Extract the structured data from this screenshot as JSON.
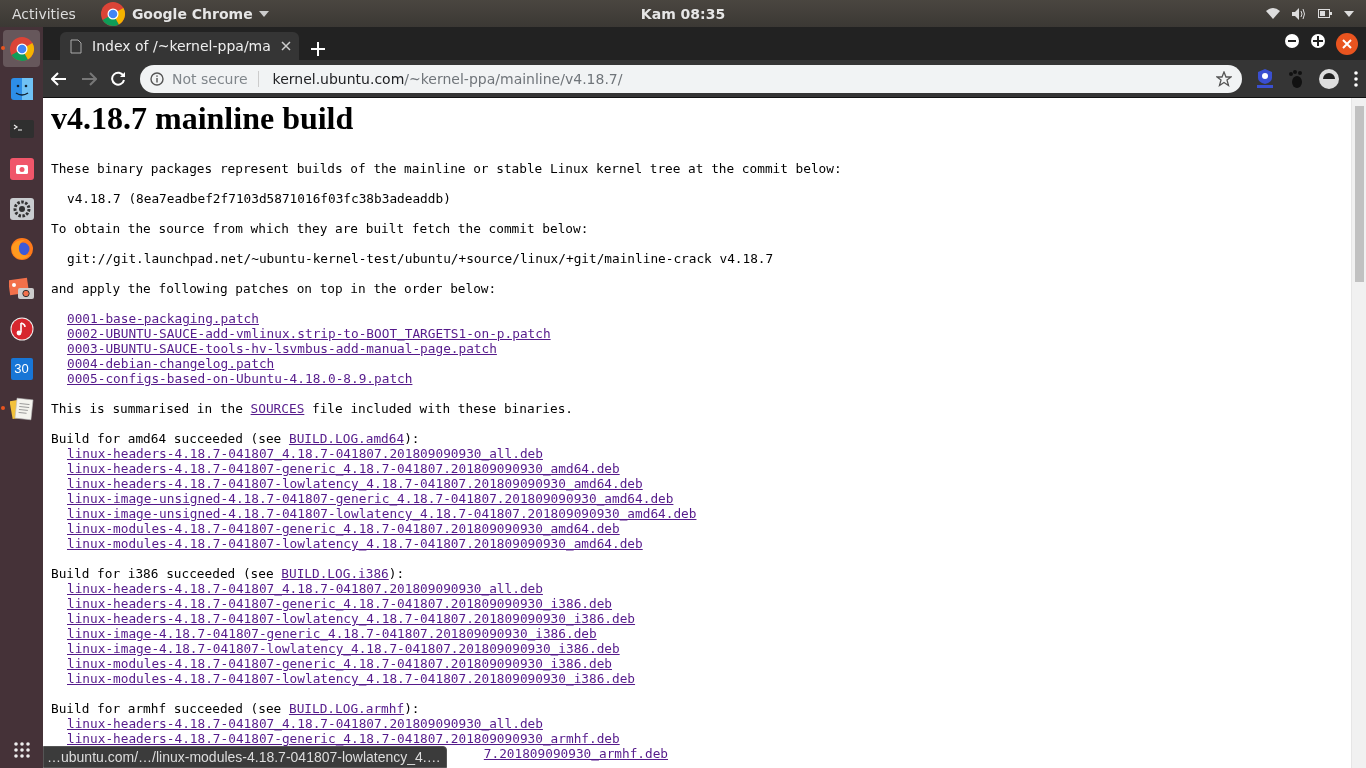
{
  "top_bar": {
    "activities": "Activities",
    "app_menu": "Google Chrome",
    "clock": "Kam 08:35"
  },
  "dock": {
    "items": [
      {
        "kind": "chrome",
        "running": true,
        "selected": true
      },
      {
        "kind": "finder",
        "running": false,
        "selected": false
      },
      {
        "kind": "terminal",
        "running": false,
        "selected": false
      },
      {
        "kind": "screenshot",
        "running": false,
        "selected": false
      },
      {
        "kind": "settings",
        "running": false,
        "selected": false
      },
      {
        "kind": "firefox",
        "running": false,
        "selected": false
      },
      {
        "kind": "photo",
        "running": false,
        "selected": false
      },
      {
        "kind": "music",
        "running": false,
        "selected": false
      },
      {
        "kind": "calendar",
        "label": "30",
        "running": false,
        "selected": false
      },
      {
        "kind": "notes",
        "running": true,
        "selected": false
      }
    ]
  },
  "browser": {
    "tabs": [
      {
        "title": "Index of /~kernel-ppa/ma",
        "selected": true
      }
    ],
    "address": {
      "security": "Not secure",
      "host": "kernel.ubuntu.com",
      "path": "/~kernel-ppa/mainline/v4.18.7/"
    }
  },
  "page": {
    "heading": "v4.18.7 mainline build",
    "intro": "These binary packages represent builds of the mainline or stable Linux kernel tree at the commit below:",
    "commit": "v4.18.7 (8ea7eadbef2f7103d5871016f03fc38b3adeaddb)",
    "source_intro": "To obtain the source from which they are built fetch the commit below:",
    "source_url": "git://git.launchpad.net/~ubuntu-kernel-test/ubuntu/+source/linux/+git/mainline-crack v4.18.7",
    "patches_intro": "and apply the following patches on top in the order below:",
    "patches": [
      "0001-base-packaging.patch",
      "0002-UBUNTU-SAUCE-add-vmlinux.strip-to-BOOT_TARGETS1-on-p.patch",
      "0003-UBUNTU-SAUCE-tools-hv-lsvmbus-add-manual-page.patch",
      "0004-debian-changelog.patch",
      "0005-configs-based-on-Ubuntu-4.18.0-8.9.patch"
    ],
    "summary": {
      "before": "This is summarised in the ",
      "link": "SOURCES",
      "after": " file included with these binaries."
    },
    "builds": [
      {
        "before": "Build for amd64 succeeded (see ",
        "log": "BUILD.LOG.amd64",
        "after": "):",
        "files": [
          "linux-headers-4.18.7-041807_4.18.7-041807.201809090930_all.deb",
          "linux-headers-4.18.7-041807-generic_4.18.7-041807.201809090930_amd64.deb",
          "linux-headers-4.18.7-041807-lowlatency_4.18.7-041807.201809090930_amd64.deb",
          "linux-image-unsigned-4.18.7-041807-generic_4.18.7-041807.201809090930_amd64.deb",
          "linux-image-unsigned-4.18.7-041807-lowlatency_4.18.7-041807.201809090930_amd64.deb",
          "linux-modules-4.18.7-041807-generic_4.18.7-041807.201809090930_amd64.deb",
          "linux-modules-4.18.7-041807-lowlatency_4.18.7-041807.201809090930_amd64.deb"
        ]
      },
      {
        "before": "Build for i386 succeeded (see ",
        "log": "BUILD.LOG.i386",
        "after": "):",
        "files": [
          "linux-headers-4.18.7-041807_4.18.7-041807.201809090930_all.deb",
          "linux-headers-4.18.7-041807-generic_4.18.7-041807.201809090930_i386.deb",
          "linux-headers-4.18.7-041807-lowlatency_4.18.7-041807.201809090930_i386.deb",
          "linux-image-4.18.7-041807-generic_4.18.7-041807.201809090930_i386.deb",
          "linux-image-4.18.7-041807-lowlatency_4.18.7-041807.201809090930_i386.deb",
          "linux-modules-4.18.7-041807-generic_4.18.7-041807.201809090930_i386.deb",
          "linux-modules-4.18.7-041807-lowlatency_4.18.7-041807.201809090930_i386.deb"
        ]
      },
      {
        "before": "Build for armhf succeeded (see ",
        "log": "BUILD.LOG.armhf",
        "after": "):",
        "files": [
          "linux-headers-4.18.7-041807_4.18.7-041807.201809090930_all.deb",
          "linux-headers-4.18.7-041807-generic_4.18.7-041807.201809090930_armhf.deb"
        ],
        "covered_file_tail": "7.201809090930_armhf.deb"
      }
    ]
  },
  "status_bubble": "…ubuntu.com/…/linux-modules-4.18.7-041807-lowlatency_4.…"
}
